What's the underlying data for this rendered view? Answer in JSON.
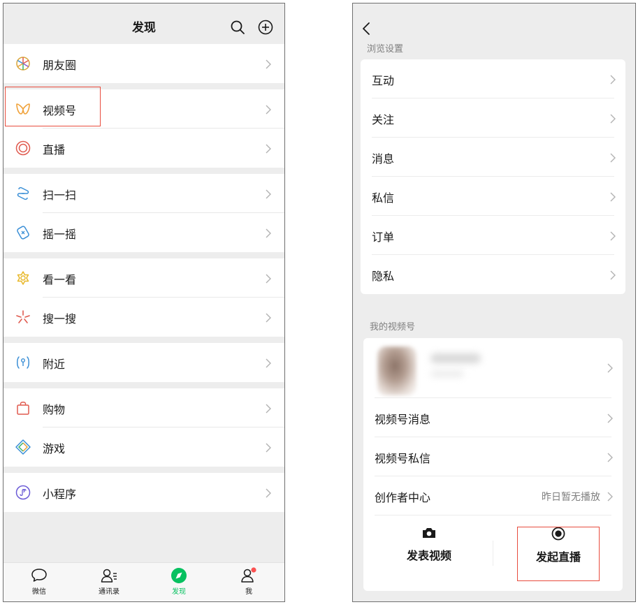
{
  "discover": {
    "title": "发现",
    "icons": {
      "search": "search-icon",
      "add": "plus-circle-icon"
    },
    "groups": [
      [
        {
          "label": "朋友圈",
          "icon": "moments-icon"
        }
      ],
      [
        {
          "label": "视频号",
          "icon": "channels-icon"
        },
        {
          "label": "直播",
          "icon": "live-icon"
        }
      ],
      [
        {
          "label": "扫一扫",
          "icon": "scan-icon"
        },
        {
          "label": "摇一摇",
          "icon": "shake-icon"
        }
      ],
      [
        {
          "label": "看一看",
          "icon": "top-stories-icon"
        },
        {
          "label": "搜一搜",
          "icon": "search-star-icon"
        }
      ],
      [
        {
          "label": "附近",
          "icon": "nearby-icon"
        }
      ],
      [
        {
          "label": "购物",
          "icon": "shopping-bag-icon"
        },
        {
          "label": "游戏",
          "icon": "games-icon"
        }
      ],
      [
        {
          "label": "小程序",
          "icon": "mini-program-icon"
        }
      ]
    ],
    "tabbar": [
      {
        "label": "微信",
        "icon": "chat-bubble-icon"
      },
      {
        "label": "通讯录",
        "icon": "contacts-icon"
      },
      {
        "label": "发现",
        "icon": "compass-icon",
        "active": true
      },
      {
        "label": "我",
        "icon": "me-icon",
        "badge": true
      }
    ]
  },
  "settings": {
    "section_browse": "浏览设置",
    "browse_items": [
      "互动",
      "关注",
      "消息",
      "私信",
      "订单",
      "隐私"
    ],
    "section_mine": "我的视频号",
    "mine_items": [
      {
        "label": "视频号消息",
        "value": ""
      },
      {
        "label": "视频号私信",
        "value": ""
      },
      {
        "label": "创作者中心",
        "value": "昨日暂无播放"
      }
    ],
    "actions": [
      {
        "label": "发表视频",
        "icon": "camera-icon"
      },
      {
        "label": "发起直播",
        "icon": "live-record-icon"
      }
    ]
  },
  "colors": {
    "accent": "#07c160",
    "highlight": "#e84c3d",
    "background": "#ededed",
    "text": "#191919",
    "secondary_text": "#7f7f7f"
  }
}
